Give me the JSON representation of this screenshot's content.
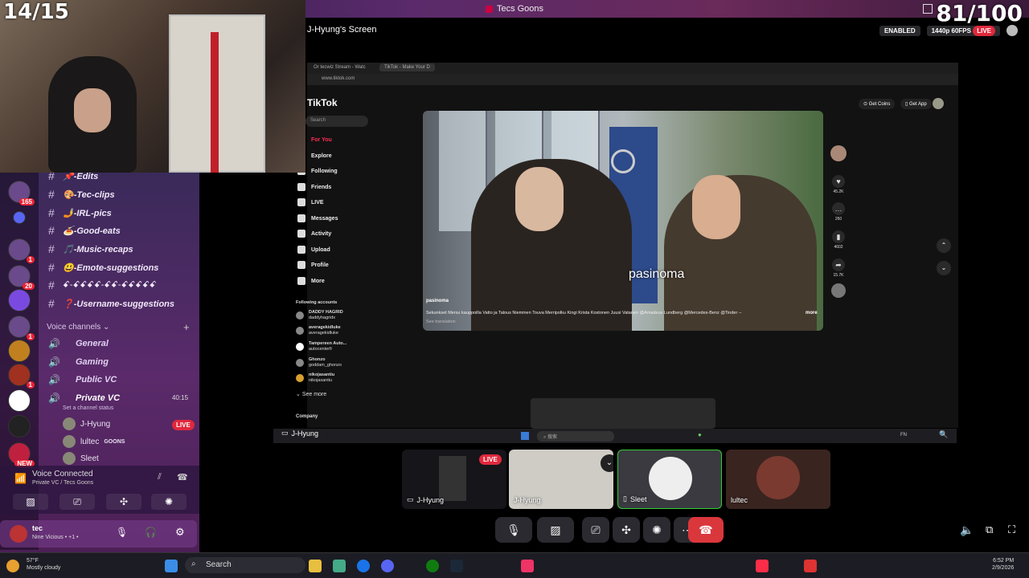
{
  "window": {
    "title": "Tecs Goons"
  },
  "overlay": {
    "counter_left": "14/15",
    "counter_right": "81/100"
  },
  "screen_share": {
    "title": "J-Hyung's Screen",
    "enabled_label": "ENABLED",
    "quality_label": "1440p 60FPS",
    "live_label": "LIVE"
  },
  "server_badges": [
    "165",
    "1",
    "20",
    "1",
    "1",
    "NEW"
  ],
  "channels": [
    {
      "name": "📌-Edits"
    },
    {
      "name": "🎨-Tec-clips"
    },
    {
      "name": "🤳-IRL-pics"
    },
    {
      "name": "🍝-Good-eats"
    },
    {
      "name": "🎵-Music-recaps"
    },
    {
      "name": "😃-Emote-suggestions"
    },
    {
      "name": "ꗃ-ꗃꗃꗃꗃ-ꗃꗃ-ꗃꗃꗃꗃꗃ"
    },
    {
      "name": "❓-Username-suggestions"
    }
  ],
  "voice_section": {
    "title": "Voice channels"
  },
  "voice_channels": [
    {
      "name": "General"
    },
    {
      "name": "Gaming"
    },
    {
      "name": "Public VC"
    },
    {
      "name": "Private VC",
      "time": "40:15",
      "status": "Set a channel status"
    }
  ],
  "voice_users": [
    {
      "name": "J-Hyung",
      "badge": "LIVE"
    },
    {
      "name": "lultec",
      "tag": "GOONS"
    },
    {
      "name": "Sleet"
    }
  ],
  "voice_connected": {
    "title": "Voice Connected",
    "subtitle": "Private VC / Tecs Goons"
  },
  "user_panel": {
    "name": "tec",
    "status": "Nine Vicious • +1 •"
  },
  "browser": {
    "tab1": "Or tecwiz Stream - Watc",
    "tab2": "TikTok - Make Your D",
    "url": "www.tiktok.com"
  },
  "tiktok": {
    "logo": "TikTok",
    "search_placeholder": "Search",
    "nav": [
      "For You",
      "Explore",
      "Following",
      "Friends",
      "LIVE",
      "Messages",
      "Activity",
      "Upload",
      "Profile",
      "More"
    ],
    "following_title": "Following accounts",
    "following": [
      {
        "name": "DADDY HAGRID",
        "handle": "daddyhagridx"
      },
      {
        "name": "averagekidluke",
        "handle": "averagekidluke"
      },
      {
        "name": "Tampereen Auto...",
        "handle": "autocenterfi"
      },
      {
        "name": "Ghonzo",
        "handle": "goddam_ghonzo"
      },
      {
        "name": "nikojasantiu",
        "handle": "nikojasantiu"
      }
    ],
    "see_more": "See more",
    "company": "Company",
    "get_coins": "Get Coins",
    "get_app": "Get App",
    "caption": "pasinoma",
    "author": "pasinoma",
    "description": "Sekunkset Mersu kauppoilla Vatto ja   Talous Nieminen Touva Merripolku Kingi Krista Kostonen Juusi Vatanen @Amadeus Lundberg  @Mercedes-Benz @Tinder --",
    "more_label": "more",
    "see_translation": "See translation",
    "stats": {
      "likes": "45.2K",
      "comments": "260",
      "saves": "4602",
      "shares": "15.7K"
    }
  },
  "inner_taskbar": {
    "search_placeholder": "搜索",
    "user_label": "J-Hyung",
    "lang": "FN"
  },
  "tiles": [
    {
      "label": "J-Hyung",
      "badge": "LIVE"
    },
    {
      "label": "J-Hyung"
    },
    {
      "label": "Sleet"
    },
    {
      "label": "lultec"
    }
  ],
  "taskbar": {
    "temp": "57°F",
    "weather": "Mostly cloudy",
    "search_placeholder": "Search",
    "time": "6:52 PM",
    "date": "2/9/2026"
  },
  "colors": {
    "accent": "#5865f2",
    "live": "#e0283c",
    "discord_purple": "#5a2a6a"
  }
}
